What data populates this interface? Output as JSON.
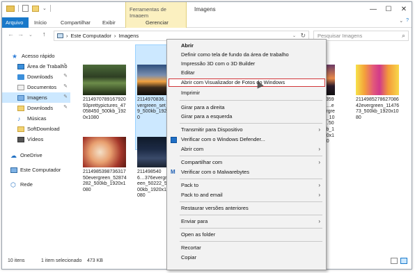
{
  "titlebar": {
    "context_tab_header": "Ferramentas de Imagem",
    "window_title": "Imagens",
    "minimize": "—",
    "maximize": "☐",
    "close": "✕"
  },
  "ribbon": {
    "tabs": [
      "Arquivo",
      "Início",
      "Compartilhar",
      "Exibir",
      "Gerenciar"
    ],
    "chevron": "⌄",
    "help": "?"
  },
  "address": {
    "back": "←",
    "forward": "→",
    "dropdown": "⌄",
    "up": "↑",
    "path": [
      "Este Computador",
      "Imagens"
    ],
    "separator": "›",
    "dd": "⌄",
    "refresh": "↻",
    "search_placeholder": "Pesquisar Imagens",
    "search_glyph": "⌕"
  },
  "navpane": {
    "items": [
      {
        "label": "Acesso rápido",
        "icon": "star-icon",
        "glyph": "★"
      },
      {
        "label": "Área de Trabalho",
        "icon": "desktop-icon",
        "pinned": true
      },
      {
        "label": "Downloads",
        "icon": "downloads-icon",
        "pinned": true
      },
      {
        "label": "Documentos",
        "icon": "documents-icon",
        "pinned": true
      },
      {
        "label": "Imagens",
        "icon": "pictures-icon",
        "pinned": true,
        "selected": true
      },
      {
        "label": "Downloads",
        "icon": "folder-icon",
        "pinned": true
      },
      {
        "label": "Músicas",
        "icon": "music-icon",
        "glyph": "♪"
      },
      {
        "label": "SoftDownload",
        "icon": "folder-icon"
      },
      {
        "label": "Vídeos",
        "icon": "videos-icon"
      },
      {
        "label": "OneDrive",
        "icon": "onedrive-icon",
        "glyph": "☁"
      },
      {
        "label": "Este Computador",
        "icon": "computer-icon"
      },
      {
        "label": "Rede",
        "icon": "network-icon",
        "glyph": "⬡"
      }
    ],
    "pin_glyph": "✎"
  },
  "files": [
    {
      "name": "211497078916792093prettypictures_47058450_500kb_1920x1080",
      "selected": false
    },
    {
      "name": "2114970836…285evergreen_set_37539_500kb_1920x1080",
      "selected": true
    },
    {
      "name": "…35955…evergreen_105…500kb_1920x1080",
      "selected": false
    },
    {
      "name": "211498527862708642evergreen_1147673_500kb_1920x1080",
      "selected": false
    },
    {
      "name": "211498539873631750evergreen_52874282_500kb_1920x1080",
      "selected": false
    },
    {
      "name": "2114985406…376evergreen_50222_500kb_1920x1080",
      "selected": false
    }
  ],
  "context_menu": {
    "items": [
      {
        "label": "Abrir",
        "bold": true
      },
      {
        "label": "Definir como tela de fundo da área de trabalho"
      },
      {
        "label": "Impressão 3D com o 3D Builder"
      },
      {
        "label": "Editar"
      },
      {
        "label": "Abrir com Visualizador de Fotos do Windows",
        "highlighted": true
      },
      {
        "label": "Imprimir"
      },
      {
        "label": "Girar para a direita"
      },
      {
        "label": "Girar para a esquerda"
      },
      {
        "label": "Transmitir para Dispositivo",
        "submenu": true
      },
      {
        "label": "Verificar com o Windows Defender...",
        "icon": "windows-defender-icon"
      },
      {
        "label": "Abrir com",
        "submenu": true
      },
      {
        "label": "Compartilhar com",
        "submenu": true
      },
      {
        "label": "Verificar com o Malwarebytes",
        "icon": "malwarebytes-icon",
        "glyph": "M"
      },
      {
        "label": "Pack to",
        "submenu": true
      },
      {
        "label": "Pack to and email",
        "submenu": true
      },
      {
        "label": "Restaurar versões anteriores"
      },
      {
        "label": "Enviar para",
        "submenu": true
      },
      {
        "label": "Open as folder"
      },
      {
        "label": "Recortar"
      },
      {
        "label": "Copiar"
      }
    ],
    "submenu_glyph": "›"
  },
  "statusbar": {
    "item_count": "10 itens",
    "selection": "1 item selecionado",
    "size": "473 KB"
  }
}
